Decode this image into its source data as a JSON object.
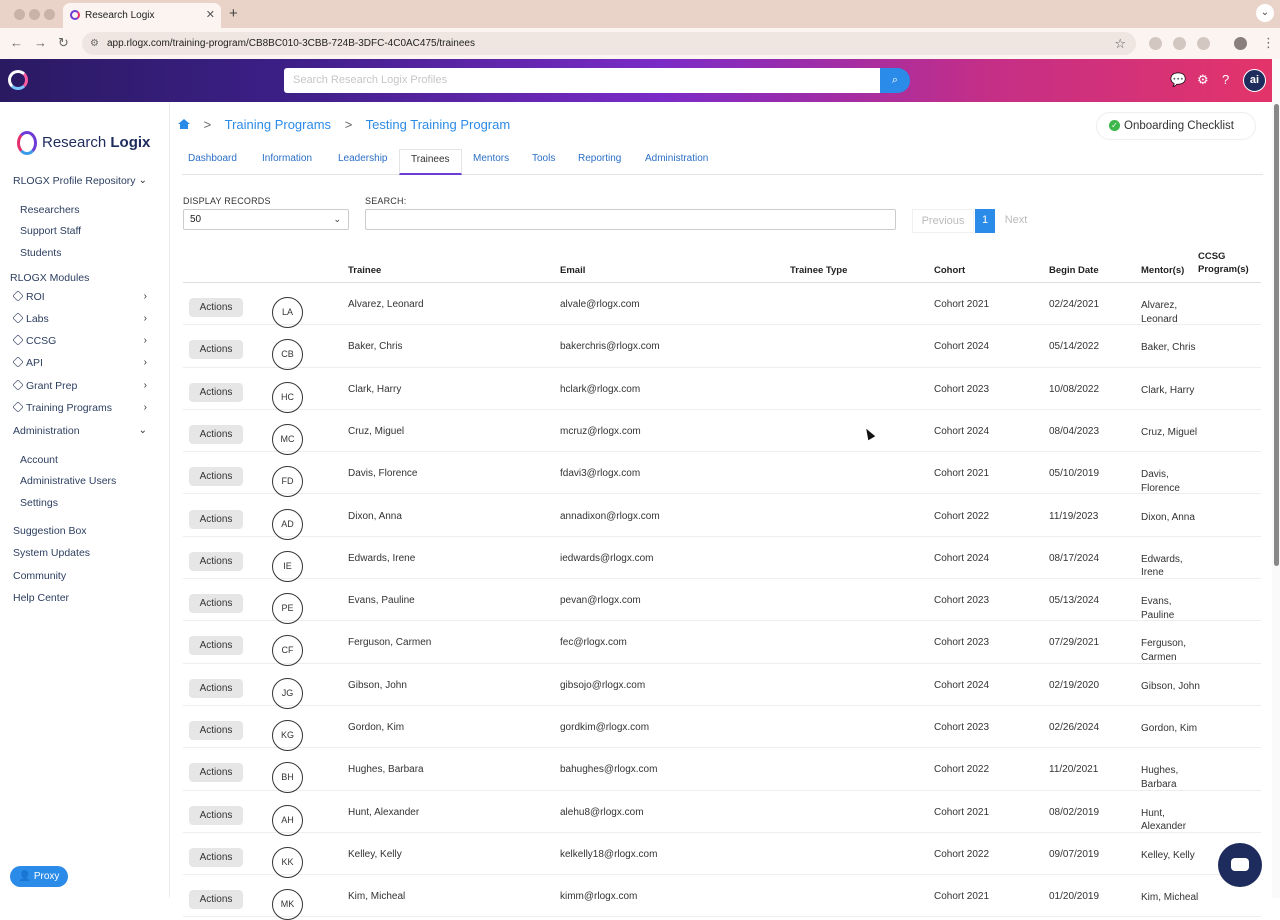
{
  "browser": {
    "tab_title": "Research Logix",
    "tab_close": "✕",
    "new_tab": "+",
    "url": "app.rlogx.com/training-program/CB8BC010-3CBB-724B-3DFC-4C0AC475/trainees"
  },
  "header": {
    "search_placeholder": "Search Research Logix Profiles",
    "ai_label": "ai"
  },
  "sidebar": {
    "brand_left": "Research",
    "brand_right": "Logix",
    "repository": "RLOGX Profile Repository",
    "repo_items": [
      "Researchers",
      "Support Staff",
      "Students"
    ],
    "modules_title": "RLOGX Modules",
    "modules": [
      "ROI",
      "Labs",
      "CCSG",
      "API",
      "Grant Prep",
      "Training Programs"
    ],
    "administration": "Administration",
    "admin_items": [
      "Account",
      "Administrative Users",
      "Settings"
    ],
    "bottom_items": [
      "Suggestion Box",
      "System Updates",
      "Community",
      "Help Center"
    ],
    "proxy": "Proxy"
  },
  "breadcrumb": {
    "items": [
      "Training Programs",
      "Testing Training Program"
    ],
    "separator": ">"
  },
  "checklist_label": "Onboarding Checklist",
  "tabs": [
    "Dashboard",
    "Information",
    "Leadership",
    "Trainees",
    "Mentors",
    "Tools",
    "Reporting",
    "Administration"
  ],
  "active_tab": "Trainees",
  "controls": {
    "display_label": "DISPLAY RECORDS",
    "display_value": "50",
    "search_label": "SEARCH:",
    "prev": "Previous",
    "page": "1",
    "next": "Next"
  },
  "table": {
    "headers": {
      "trainee": "Trainee",
      "email": "Email",
      "type": "Trainee Type",
      "cohort": "Cohort",
      "begin": "Begin Date",
      "mentor": "Mentor(s)",
      "ccsg": "CCSG Program(s)"
    },
    "action_label": "Actions",
    "rows": [
      {
        "initials": "LA",
        "name": "Alvarez, Leonard",
        "email": "alvale@rlogx.com",
        "type": "",
        "cohort": "Cohort 2021",
        "begin": "02/24/2021",
        "mentor": "Alvarez, Leonard",
        "ccsg": ""
      },
      {
        "initials": "CB",
        "name": "Baker, Chris",
        "email": "bakerchris@rlogx.com",
        "type": "",
        "cohort": "Cohort 2024",
        "begin": "05/14/2022",
        "mentor": "Baker, Chris",
        "ccsg": ""
      },
      {
        "initials": "HC",
        "name": "Clark, Harry",
        "email": "hclark@rlogx.com",
        "type": "",
        "cohort": "Cohort 2023",
        "begin": "10/08/2022",
        "mentor": "Clark, Harry",
        "ccsg": ""
      },
      {
        "initials": "MC",
        "name": "Cruz, Miguel",
        "email": "mcruz@rlogx.com",
        "type": "",
        "cohort": "Cohort 2024",
        "begin": "08/04/2023",
        "mentor": "Cruz, Miguel",
        "ccsg": ""
      },
      {
        "initials": "FD",
        "name": "Davis, Florence",
        "email": "fdavi3@rlogx.com",
        "type": "",
        "cohort": "Cohort 2021",
        "begin": "05/10/2019",
        "mentor": "Davis, Florence",
        "ccsg": ""
      },
      {
        "initials": "AD",
        "name": "Dixon, Anna",
        "email": "annadixon@rlogx.com",
        "type": "",
        "cohort": "Cohort 2022",
        "begin": "11/19/2023",
        "mentor": "Dixon, Anna",
        "ccsg": ""
      },
      {
        "initials": "IE",
        "name": "Edwards, Irene",
        "email": "iedwards@rlogx.com",
        "type": "",
        "cohort": "Cohort 2024",
        "begin": "08/17/2024",
        "mentor": "Edwards, Irene",
        "ccsg": ""
      },
      {
        "initials": "PE",
        "name": "Evans, Pauline",
        "email": "pevan@rlogx.com",
        "type": "",
        "cohort": "Cohort 2023",
        "begin": "05/13/2024",
        "mentor": "Evans, Pauline",
        "ccsg": ""
      },
      {
        "initials": "CF",
        "name": "Ferguson, Carmen",
        "email": "fec@rlogx.com",
        "type": "",
        "cohort": "Cohort 2023",
        "begin": "07/29/2021",
        "mentor": "Ferguson, Carmen",
        "ccsg": ""
      },
      {
        "initials": "JG",
        "name": "Gibson, John",
        "email": "gibsojo@rlogx.com",
        "type": "",
        "cohort": "Cohort 2024",
        "begin": "02/19/2020",
        "mentor": "Gibson, John",
        "ccsg": ""
      },
      {
        "initials": "KG",
        "name": "Gordon, Kim",
        "email": "gordkim@rlogx.com",
        "type": "",
        "cohort": "Cohort 2023",
        "begin": "02/26/2024",
        "mentor": "Gordon, Kim",
        "ccsg": ""
      },
      {
        "initials": "BH",
        "name": "Hughes, Barbara",
        "email": "bahughes@rlogx.com",
        "type": "",
        "cohort": "Cohort 2022",
        "begin": "11/20/2021",
        "mentor": "Hughes, Barbara",
        "ccsg": ""
      },
      {
        "initials": "AH",
        "name": "Hunt, Alexander",
        "email": "alehu8@rlogx.com",
        "type": "",
        "cohort": "Cohort 2021",
        "begin": "08/02/2019",
        "mentor": "Hunt, Alexander",
        "ccsg": ""
      },
      {
        "initials": "KK",
        "name": "Kelley, Kelly",
        "email": "kelkelly18@rlogx.com",
        "type": "",
        "cohort": "Cohort 2022",
        "begin": "09/07/2019",
        "mentor": "Kelley, Kelly",
        "ccsg": ""
      },
      {
        "initials": "MK",
        "name": "Kim, Micheal",
        "email": "kimm@rlogx.com",
        "type": "",
        "cohort": "Cohort 2021",
        "begin": "01/20/2019",
        "mentor": "Kim, Micheal",
        "ccsg": ""
      }
    ]
  },
  "colors": {
    "accent": "#2b8be8",
    "nav_dark": "#1e2c5d",
    "tab_underline": "#6d3bd6"
  }
}
